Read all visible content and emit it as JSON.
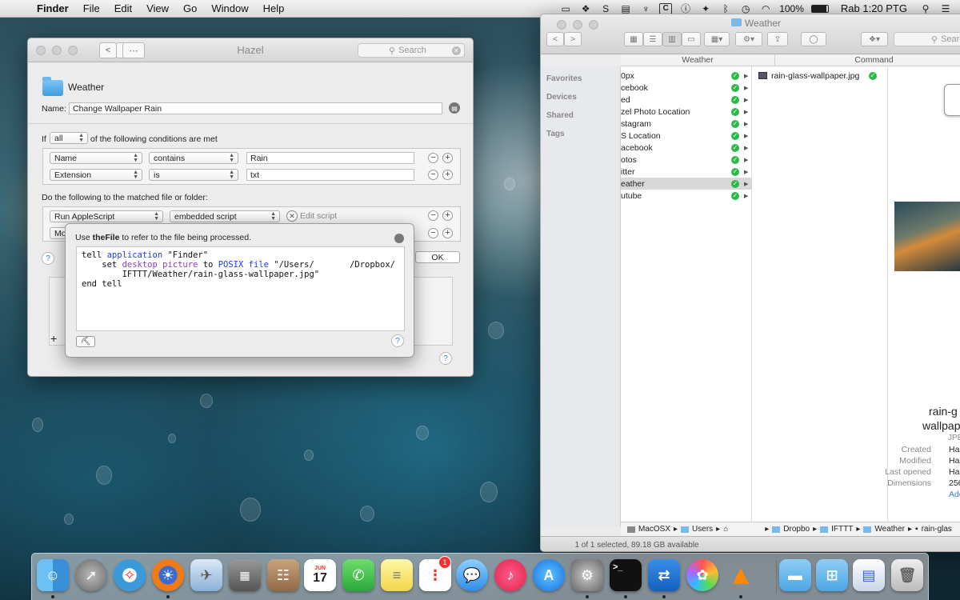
{
  "menubar": {
    "app": "Finder",
    "menus": [
      "File",
      "Edit",
      "View",
      "Go",
      "Window",
      "Help"
    ],
    "battery": "100%",
    "clock": "Rab 1:20 PTG"
  },
  "hazel": {
    "title": "Hazel",
    "search_placeholder": "Search",
    "folder_name": "Weather",
    "name_label": "Name:",
    "rule_name": "Change Wallpaper Rain",
    "if_label": "If",
    "match_mode": "all",
    "conditions_suffix": "of the following conditions are met",
    "conditions": [
      {
        "attribute": "Name",
        "operator": "contains",
        "value": "Rain"
      },
      {
        "attribute": "Extension",
        "operator": "is",
        "value": "txt"
      }
    ],
    "actions_label": "Do the following to the matched file or folder:",
    "actions": [
      {
        "action": "Run AppleScript",
        "option": "embedded script",
        "edit_label": "Edit script"
      },
      {
        "action": "Mo"
      }
    ],
    "ok_label": "OK",
    "help_label": "?",
    "add_label": "+",
    "remove_label": "−"
  },
  "script_popover": {
    "hint_prefix": "Use ",
    "hint_bold": "theFile",
    "hint_suffix": " to refer to the file being processed.",
    "code": {
      "l1a": "tell ",
      "l1b": "application",
      "l1c": " \"Finder\"",
      "l2a": "    set ",
      "l2b": "desktop picture",
      "l2c": " to ",
      "l2d": "POSIX file",
      "l2e": " \"/Users/       /Dropbox/",
      "l3": "        IFTTT/Weather/rain-glass-wallpaper.jpg\"",
      "l4": "end tell"
    },
    "compile_glyph": "⛏",
    "help_label": "?"
  },
  "finder": {
    "title": "Weather",
    "search_placeholder": "Searc",
    "col_head_1": "Weather",
    "col_head_2": "Command",
    "sidebar": [
      "Favorites",
      "Devices",
      "Shared",
      "Tags"
    ],
    "items": [
      "0px",
      "cebook",
      "ed",
      "zel Photo Location",
      "stagram",
      "S Location",
      "acebook",
      "otos",
      "itter",
      "eather",
      "utube"
    ],
    "selected_index": 9,
    "file": "rain-glass-wallpaper.jpg",
    "preview_name_1": "rain-g",
    "preview_name_2": "wallpap",
    "preview_kind": "JPE",
    "info_labels": [
      "Created",
      "Modified",
      "Last opened",
      "Dimensions"
    ],
    "info_values": [
      "Ha",
      "Ha",
      "Ha",
      "256"
    ],
    "info_add": "Add",
    "path": [
      "MacOSX",
      "Users",
      "Dropbo",
      "IFTTT",
      "Weather",
      "rain-glas"
    ],
    "status": "1 of 1 selected, 89.18 GB available"
  },
  "dock": {
    "calendar_month": "JUN",
    "calendar_day": "17",
    "reminders_badge": "1",
    "terminal_glyph": ">_"
  }
}
